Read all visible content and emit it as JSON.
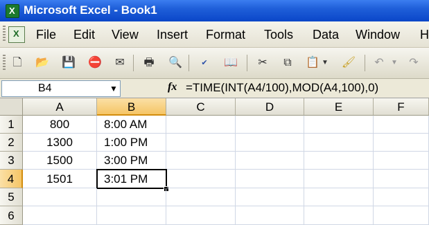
{
  "window": {
    "title": "Microsoft Excel - Book1"
  },
  "menu": [
    "File",
    "Edit",
    "View",
    "Insert",
    "Format",
    "Tools",
    "Data",
    "Window",
    "H"
  ],
  "toolbar": {
    "icons": [
      "new-icon",
      "open-icon",
      "save-icon",
      "permission-icon",
      "email-icon",
      "print-icon",
      "print-preview-icon",
      "spelling-icon",
      "research-icon",
      "cut-icon",
      "copy-icon",
      "paste-icon",
      "paste-dropdown-icon",
      "format-painter-icon",
      "undo-icon",
      "undo-dropdown-icon",
      "redo-icon"
    ]
  },
  "formula_bar": {
    "name_box": "B4",
    "fx": "fx",
    "formula": "=TIME(INT(A4/100),MOD(A4,100),0)"
  },
  "sheet": {
    "columns": [
      "A",
      "B",
      "C",
      "D",
      "E",
      "F"
    ],
    "rows": [
      "1",
      "2",
      "3",
      "4",
      "5",
      "6"
    ],
    "cells": {
      "A1": "800",
      "B1": "8:00 AM",
      "A2": "1300",
      "B2": "1:00 PM",
      "A3": "1500",
      "B3": "3:00 PM",
      "A4": "1501",
      "B4": "3:01 PM"
    },
    "active_cell": "B4"
  }
}
